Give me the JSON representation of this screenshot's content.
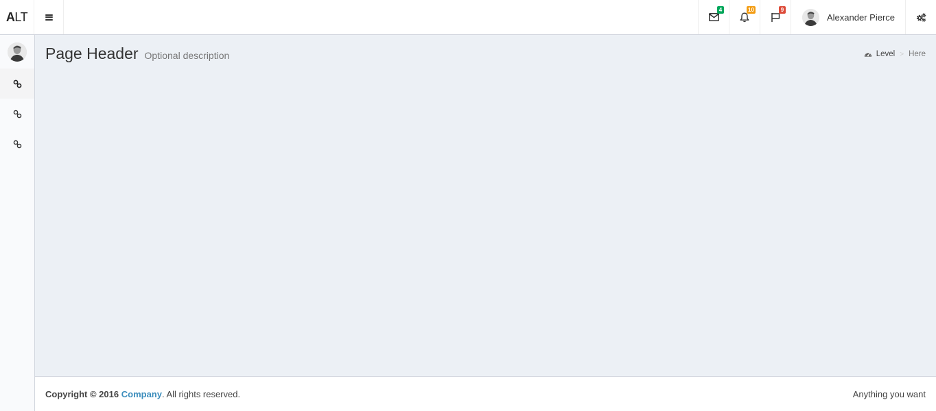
{
  "header": {
    "logo_bold": "A",
    "logo_rest": "LT",
    "messages_badge": "4",
    "notifications_badge": "10",
    "tasks_badge": "9",
    "user_name": "Alexander Pierce",
    "colors": {
      "green": "#00a65a",
      "orange": "#f39c12",
      "red": "#dd4b39"
    },
    "icons": [
      "bars-icon",
      "envelope-icon",
      "bell-icon",
      "flag-icon",
      "gears-icon"
    ]
  },
  "sidebar": {
    "items": [
      {
        "icon": "link-icon",
        "active": true
      },
      {
        "icon": "link-icon",
        "active": false
      },
      {
        "icon": "link-icon",
        "active": false
      }
    ]
  },
  "content": {
    "title": "Page Header",
    "description": "Optional description",
    "breadcrumb": {
      "level": "Level",
      "separator": ">",
      "here": "Here"
    }
  },
  "footer": {
    "copyright_prefix": "Copyright © 2016",
    "company": "Company",
    "suffix": ". All rights reserved.",
    "right_text": "Anything you want",
    "link_color": "#3c8dbc"
  }
}
